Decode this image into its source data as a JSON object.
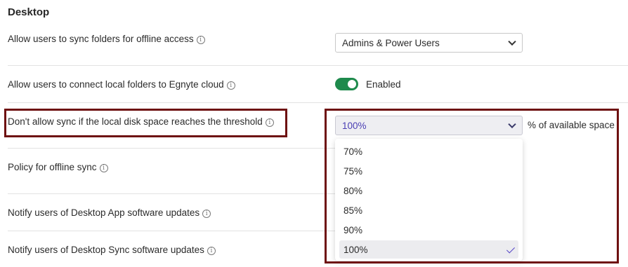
{
  "section": {
    "title": "Desktop"
  },
  "rows": [
    {
      "label": "Allow users to sync folders for offline access"
    },
    {
      "label": "Allow users to connect local folders to Egnyte cloud"
    },
    {
      "label": "Don't allow sync if the local disk space reaches the threshold"
    },
    {
      "label": "Policy for offline sync"
    },
    {
      "label": "Notify users of Desktop App software updates"
    },
    {
      "label": "Notify users of Desktop Sync software updates"
    }
  ],
  "info_icon": "ⓘ",
  "sync_folders_select": {
    "value": "Admins & Power Users"
  },
  "connect_toggle": {
    "state": "on",
    "label": "Enabled",
    "color": "#1e8a4c"
  },
  "threshold_select": {
    "value": "100%",
    "unit_label": "% of available space",
    "options": [
      "70%",
      "75%",
      "80%",
      "85%",
      "90%",
      "100%"
    ],
    "selected_index": 5
  },
  "colors": {
    "highlight": "#6e1111",
    "accent": "#5646c8",
    "selected_text": "#4b3fb4"
  }
}
